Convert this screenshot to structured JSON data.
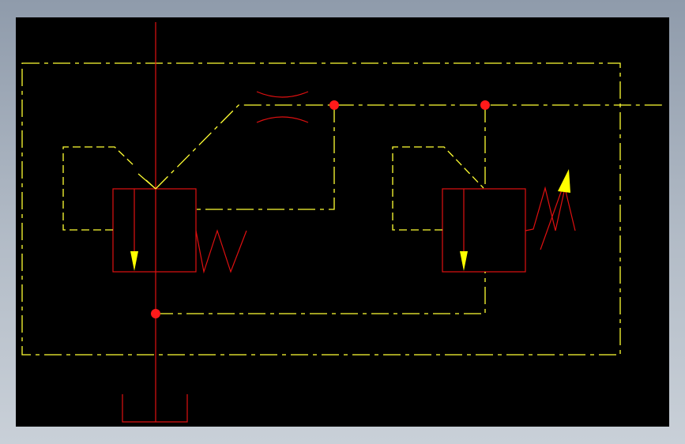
{
  "colors": {
    "background": "#000000",
    "pilot_line": "#ffff33",
    "main_line": "#e01010",
    "junction": "#ff1a1a",
    "arrow": "#ffff00"
  },
  "icons": {
    "valve_1": "pressure-reducing-valve-fixed-spring-icon",
    "valve_2": "pressure-relief-valve-adjustable-spring-icon",
    "orifice": "throttle-orifice-icon",
    "tank": "tank-reservoir-icon"
  }
}
